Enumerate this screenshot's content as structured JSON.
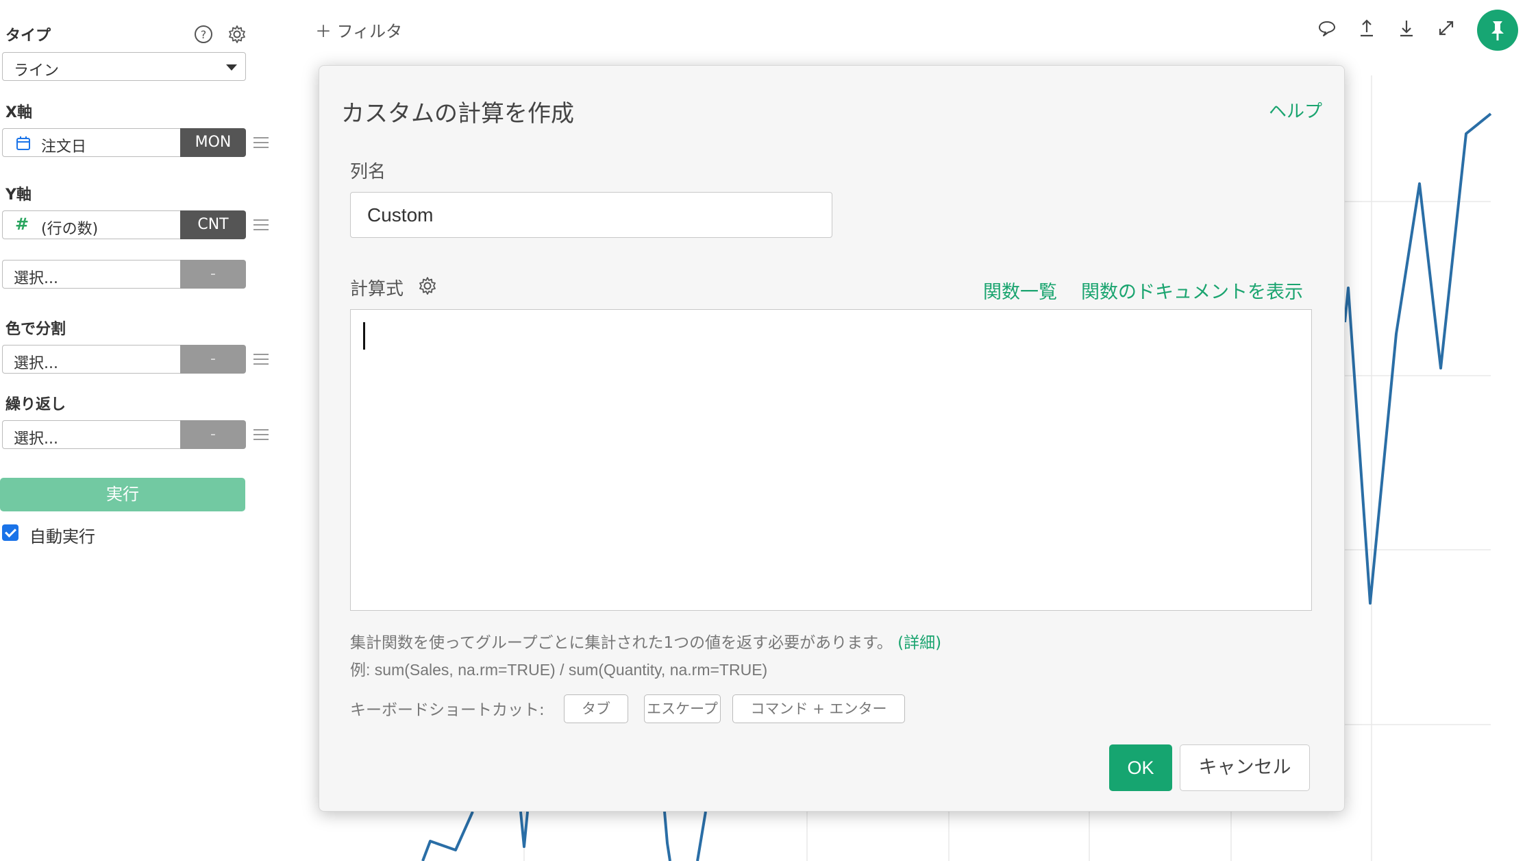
{
  "sidebar": {
    "type_label": "タイプ",
    "type_value": "ライン",
    "x_axis_label": "X軸",
    "x_field": "注文日",
    "x_agg": "MON",
    "y_axis_label": "Y軸",
    "y_field": "(行の数)",
    "y_agg": "CNT",
    "y2_placeholder": "選択...",
    "y2_agg": "-",
    "color_label": "色で分割",
    "color_placeholder": "選択...",
    "color_agg": "-",
    "repeat_label": "繰り返し",
    "repeat_placeholder": "選択...",
    "repeat_agg": "-",
    "run_label": "実行",
    "auto_run_label": "自動実行",
    "auto_run_checked": true
  },
  "toolbar": {
    "filter_label": "＋ フィルタ",
    "icons": [
      "comment-icon",
      "upload-icon",
      "download-icon",
      "expand-icon",
      "pin-icon"
    ],
    "pin_color": "#17a673"
  },
  "modal": {
    "title": "カスタムの計算を作成",
    "help": "ヘルプ",
    "column_name_label": "列名",
    "column_name_value": "Custom",
    "formula_label": "計算式",
    "function_list_link": "関数一覧",
    "function_docs_link": "関数のドキュメントを表示",
    "formula_value": "",
    "hint_main": "集計関数を使ってグループごとに集計された1つの値を返す必要があります。",
    "hint_detail": "(詳細)",
    "example": "例: sum(Sales, na.rm=TRUE) / sum(Quantity, na.rm=TRUE)",
    "shortcut_label": "キーボードショートカット:",
    "shortcuts": [
      "タブ",
      "エスケープ",
      "コマンド + エンター"
    ],
    "ok": "OK",
    "cancel": "キャンセル"
  },
  "colors": {
    "accent": "#1aa46f",
    "line": "#2a6ea6",
    "run_button": "#72c9a2"
  }
}
